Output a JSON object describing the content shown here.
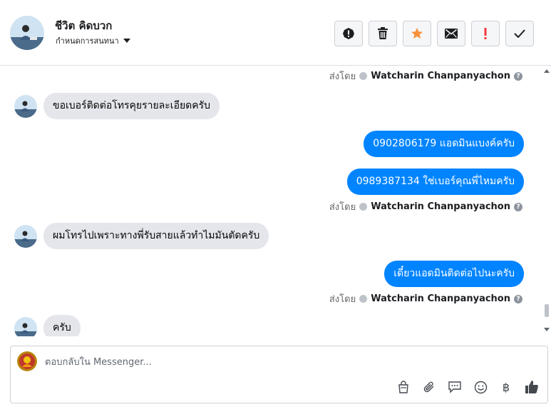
{
  "header": {
    "contact_name": "ชีวิต คิดบวก",
    "assign_label": "กำหนดการสนทนา",
    "actions": [
      {
        "name": "spam-button",
        "icon": "alert-circle-icon"
      },
      {
        "name": "delete-button",
        "icon": "trash-icon"
      },
      {
        "name": "star-button",
        "icon": "star-icon",
        "color": "#f7923b"
      },
      {
        "name": "mark-unread-button",
        "icon": "envelope-icon"
      },
      {
        "name": "follow-up-button",
        "icon": "exclamation-icon",
        "color": "#fa383e"
      },
      {
        "name": "mark-done-button",
        "icon": "checkmark-icon"
      }
    ]
  },
  "thread": {
    "sent_by_label": "ส่งโดย",
    "sender_name": "Watcharin Chanpanyachon",
    "help_glyph": "?",
    "messages": [
      {
        "dir": "in",
        "text": "ขอเบอร์ติดต่อโทรคุยรายละเอียดครับ"
      },
      {
        "dir": "out",
        "text": "0902806179 แอดมินแบงค์ครับ"
      },
      {
        "dir": "out",
        "text": "0989387134 ใช่เบอร์คุณพี่ไหมครับ"
      },
      {
        "dir": "in",
        "text": "ผมโทรไปเพราะทางพี่รับสายแล้วทำไมมันตัดครับ"
      },
      {
        "dir": "out",
        "text": "เดี๋ยวแอดมินติดต่อไปนะครับ"
      },
      {
        "dir": "in",
        "text": "ครับ"
      }
    ]
  },
  "composer": {
    "placeholder": "ตอบกลับใน Messenger...",
    "tools": [
      "shopping-bag-icon",
      "paperclip-icon",
      "saved-reply-icon",
      "emoji-icon",
      "baht-icon",
      "thumbs-up-icon"
    ],
    "baht_glyph": "฿"
  },
  "colors": {
    "outgoing_bubble": "#0084ff",
    "incoming_bubble": "#e4e6eb",
    "star": "#f7923b",
    "follow_up": "#fa383e"
  }
}
